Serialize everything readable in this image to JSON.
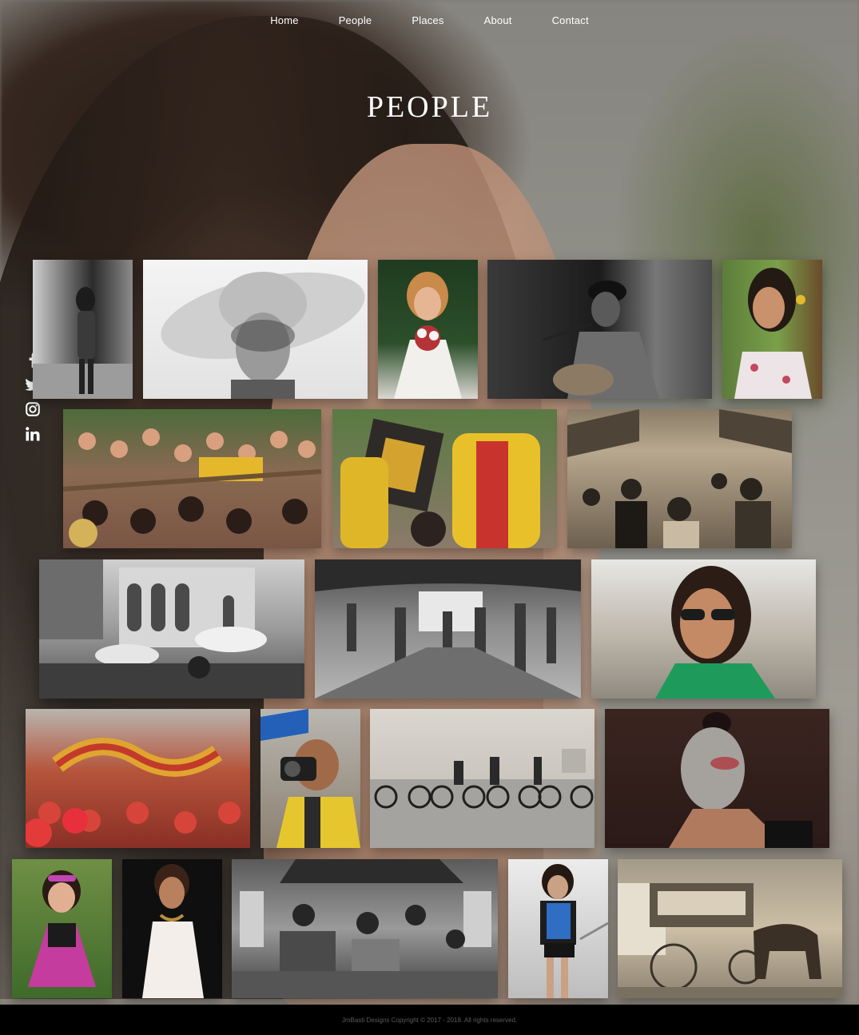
{
  "nav": {
    "items": [
      "Home",
      "People",
      "Places",
      "About",
      "Contact"
    ]
  },
  "page": {
    "title": "PEOPLE"
  },
  "social": {
    "icons": [
      "facebook-icon",
      "twitter-icon",
      "instagram-icon",
      "linkedin-icon"
    ],
    "glyphs": [
      "f",
      "",
      "",
      "in"
    ]
  },
  "gallery": {
    "photos": [
      "woman-in-corridor-photo",
      "woman-in-sunhat-photo",
      "bride-with-bouquet-photo",
      "street-guitarist-photo",
      "woman-with-flower-photo",
      "festival-crowd-photo",
      "devotees-with-icon-photo",
      "market-crowd-photo",
      "church-umbrellas-photo",
      "train-station-photo",
      "woman-in-sunglasses-photo",
      "dragon-dance-photo",
      "photographer-photo",
      "cyclists-on-seawall-photo",
      "face-paint-portrait-photo",
      "little-girl-photo",
      "woman-in-white-dress-photo",
      "street-market-photo",
      "woman-on-stairs-photo",
      "horse-carriage-photo"
    ]
  },
  "footer": {
    "text": "JmBasti Designs Copyright © 2017 - 2018. All rights reserved."
  }
}
